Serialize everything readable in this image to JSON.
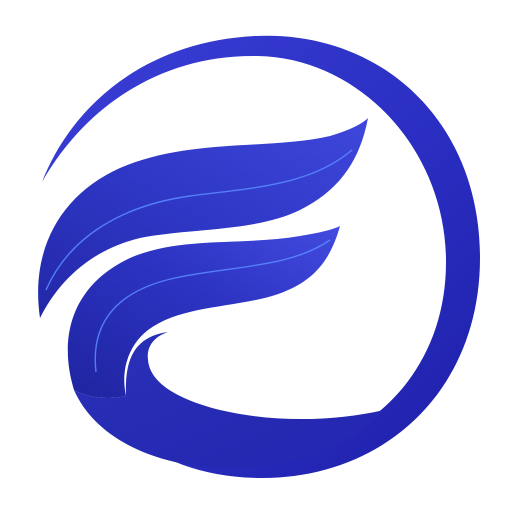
{
  "logo": {
    "icon": "stylized-letter-e-swoosh-icon",
    "colors": {
      "background": "#ffffff",
      "ring_dark": "#1e1fa8",
      "ring_light": "#3a3fd6",
      "swoosh_dark": "#1f24a6",
      "swoosh_mid": "#2e35c8",
      "swoosh_light": "#4a52e4",
      "highlight_line": "#5a8cff"
    }
  }
}
